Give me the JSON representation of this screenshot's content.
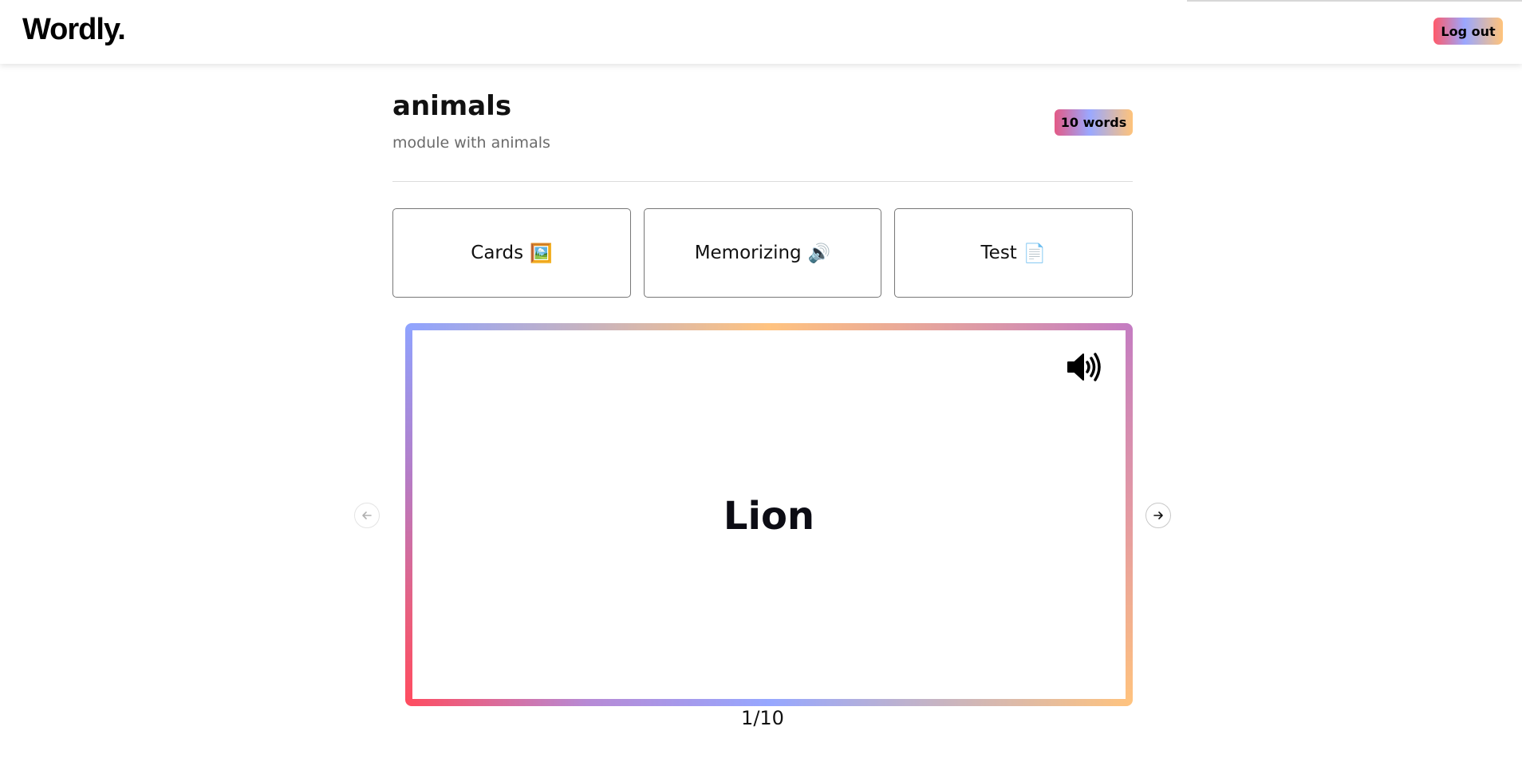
{
  "header": {
    "logo": "Wordly.",
    "logout_label": "Log out"
  },
  "module": {
    "title": "animals",
    "description": "module with animals",
    "word_count_badge": "10 words"
  },
  "modes": [
    {
      "label": "Cards",
      "emoji": "🖼️"
    },
    {
      "label": "Memorizing",
      "emoji": "🔊"
    },
    {
      "label": "Test",
      "emoji": "📄"
    }
  ],
  "card": {
    "word": "Lion",
    "speaker_icon": "speaker-icon"
  },
  "navigation": {
    "prev_icon": "arrow-left-icon",
    "next_icon": "arrow-right-icon",
    "counter": "1/10"
  }
}
